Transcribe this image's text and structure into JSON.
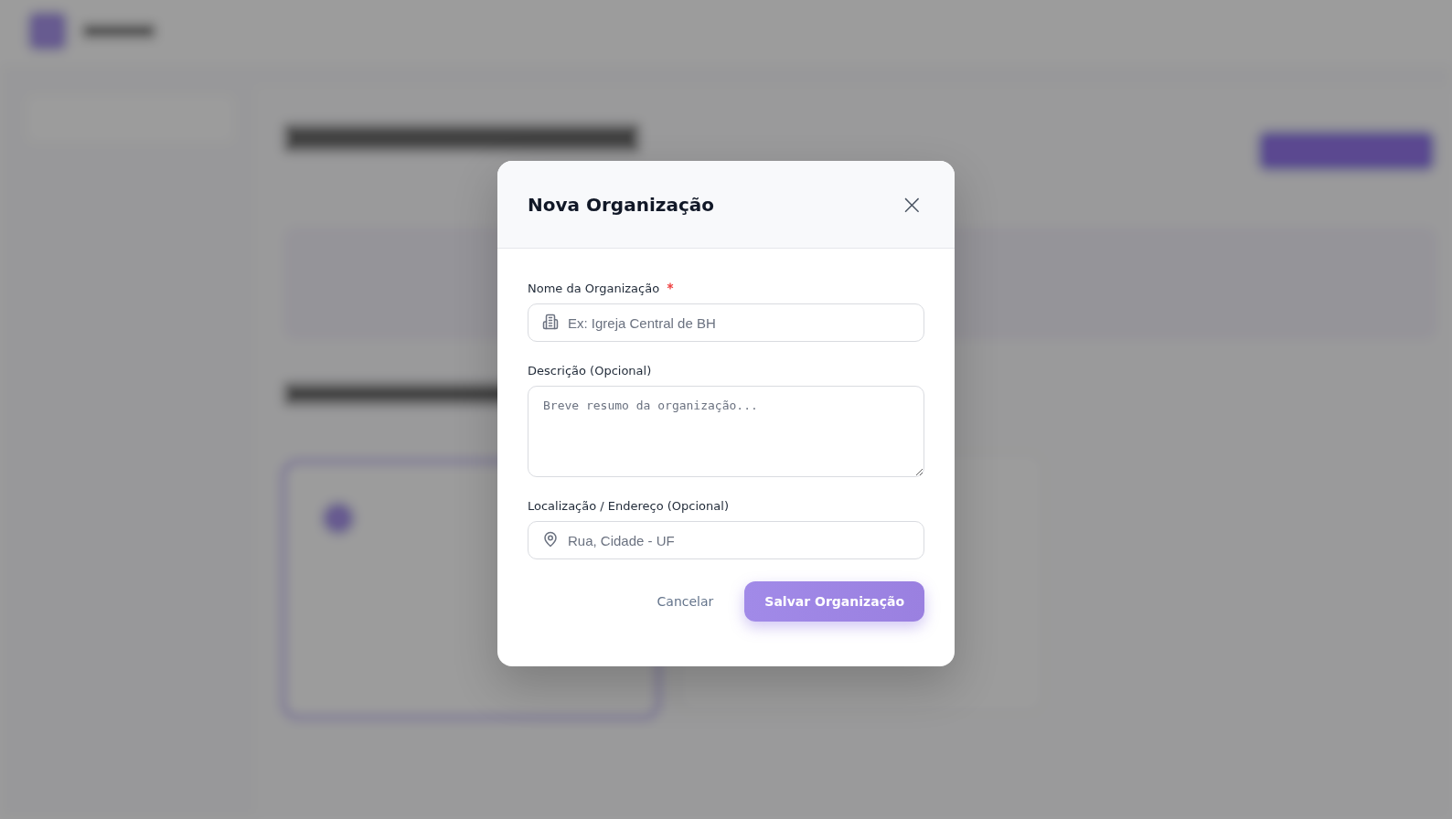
{
  "dialog": {
    "title": "Nova Organização",
    "close": "×",
    "fields": [
      {
        "kind": "building_input",
        "label": "Nome da Organização",
        "required": true,
        "placeholder": "Ex: Igreja Central de BH"
      },
      {
        "kind": "textarea",
        "label": "Descrição (Opcional)",
        "required": false,
        "placeholder": "Breve resumo da organização..."
      },
      {
        "kind": "location_input",
        "label": "Localização / Endereço (Opcional)",
        "required": false,
        "placeholder": "Rua, Cidade - UF"
      }
    ],
    "cancel": "Cancelar",
    "save": {
      "label": "Salvar Organização",
      "disabled": true
    }
  }
}
